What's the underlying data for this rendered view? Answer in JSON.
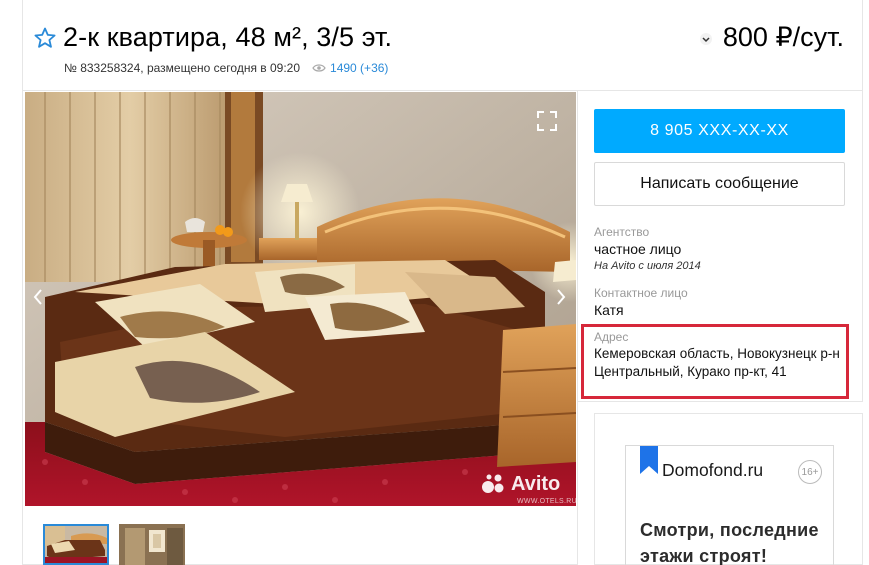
{
  "header": {
    "title": "2-к квартира, 48 м², 3/5 эт.",
    "price": "800 ₽/сут.",
    "meta_text": "№ 833258324, размещено сегодня в 09:20",
    "views": "1490 (+36)"
  },
  "gallery": {
    "watermark": "Avito",
    "watermark_small": "WWW.OTELS.RU"
  },
  "contact": {
    "phone_label": "8 905 XXX-XX-XX",
    "message_label": "Написать сообщение",
    "agency_label": "Агентство",
    "agency_value": "частное лицо",
    "agency_since": "На Avito с июля 2014",
    "person_label": "Контактное лицо",
    "person_value": "Катя",
    "address_label": "Адрес",
    "address_line1": "Кемеровская область, Новокузнецк р-н",
    "address_line2": "Центральный, Курако пр-кт, 41"
  },
  "ad": {
    "brand": "Domofond.ru",
    "age": "16+",
    "text": "Смотри, последние этажи строят!"
  },
  "colors": {
    "accent": "#00aaff",
    "link": "#2a8ad8",
    "highlight": "#d6273a"
  }
}
